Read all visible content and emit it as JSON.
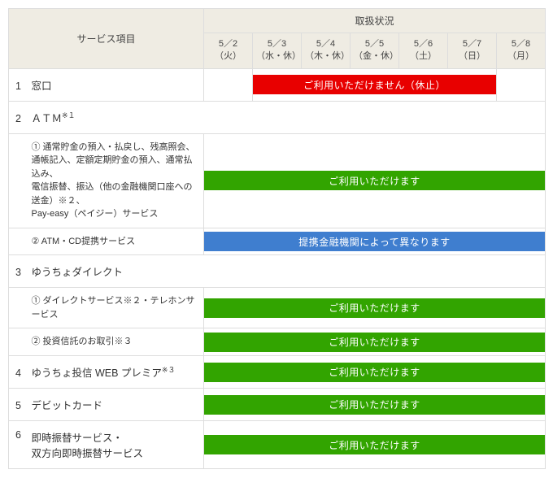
{
  "header": {
    "service_col": "サービス項目",
    "status_col": "取扱状況",
    "days": [
      "5／2\n（火）",
      "5／3\n（水・休）",
      "5／4\n（木・休）",
      "5／5\n（金・休）",
      "5／6\n（土）",
      "5／7\n（日）",
      "5／8\n（月）"
    ]
  },
  "rows": [
    {
      "num": "1",
      "label": "窓口"
    },
    {
      "num": "2",
      "label": "ＡＴＭ",
      "sup": "※１"
    },
    {
      "num": "3",
      "label": "ゆうちょダイレクト"
    },
    {
      "num": "4",
      "label": "ゆうちょ投信 WEB プレミア",
      "sup": "※３"
    },
    {
      "num": "5",
      "label": "デビットカード"
    },
    {
      "num": "6",
      "label": "即時振替サービス・\n双方向即時振替サービス"
    }
  ],
  "subrows": {
    "atm1": "① 通常貯金の預入・払戻し、残高照会、\n通帳記入、定額定期貯金の預入、通常払込み、\n電信振替、振込（他の金融機関口座への送金）※２、\nPay-easy（ペイジー）サービス",
    "atm2": "② ATM・CD提携サービス",
    "direct1": "① ダイレクトサービス※２・テレホンサービス",
    "direct2": "② 投資信託のお取引※３"
  },
  "bars": {
    "unavailable": "ご利用いただけません（休止）",
    "available": "ご利用いただけます",
    "varies": "提携金融機関によって異なります"
  }
}
